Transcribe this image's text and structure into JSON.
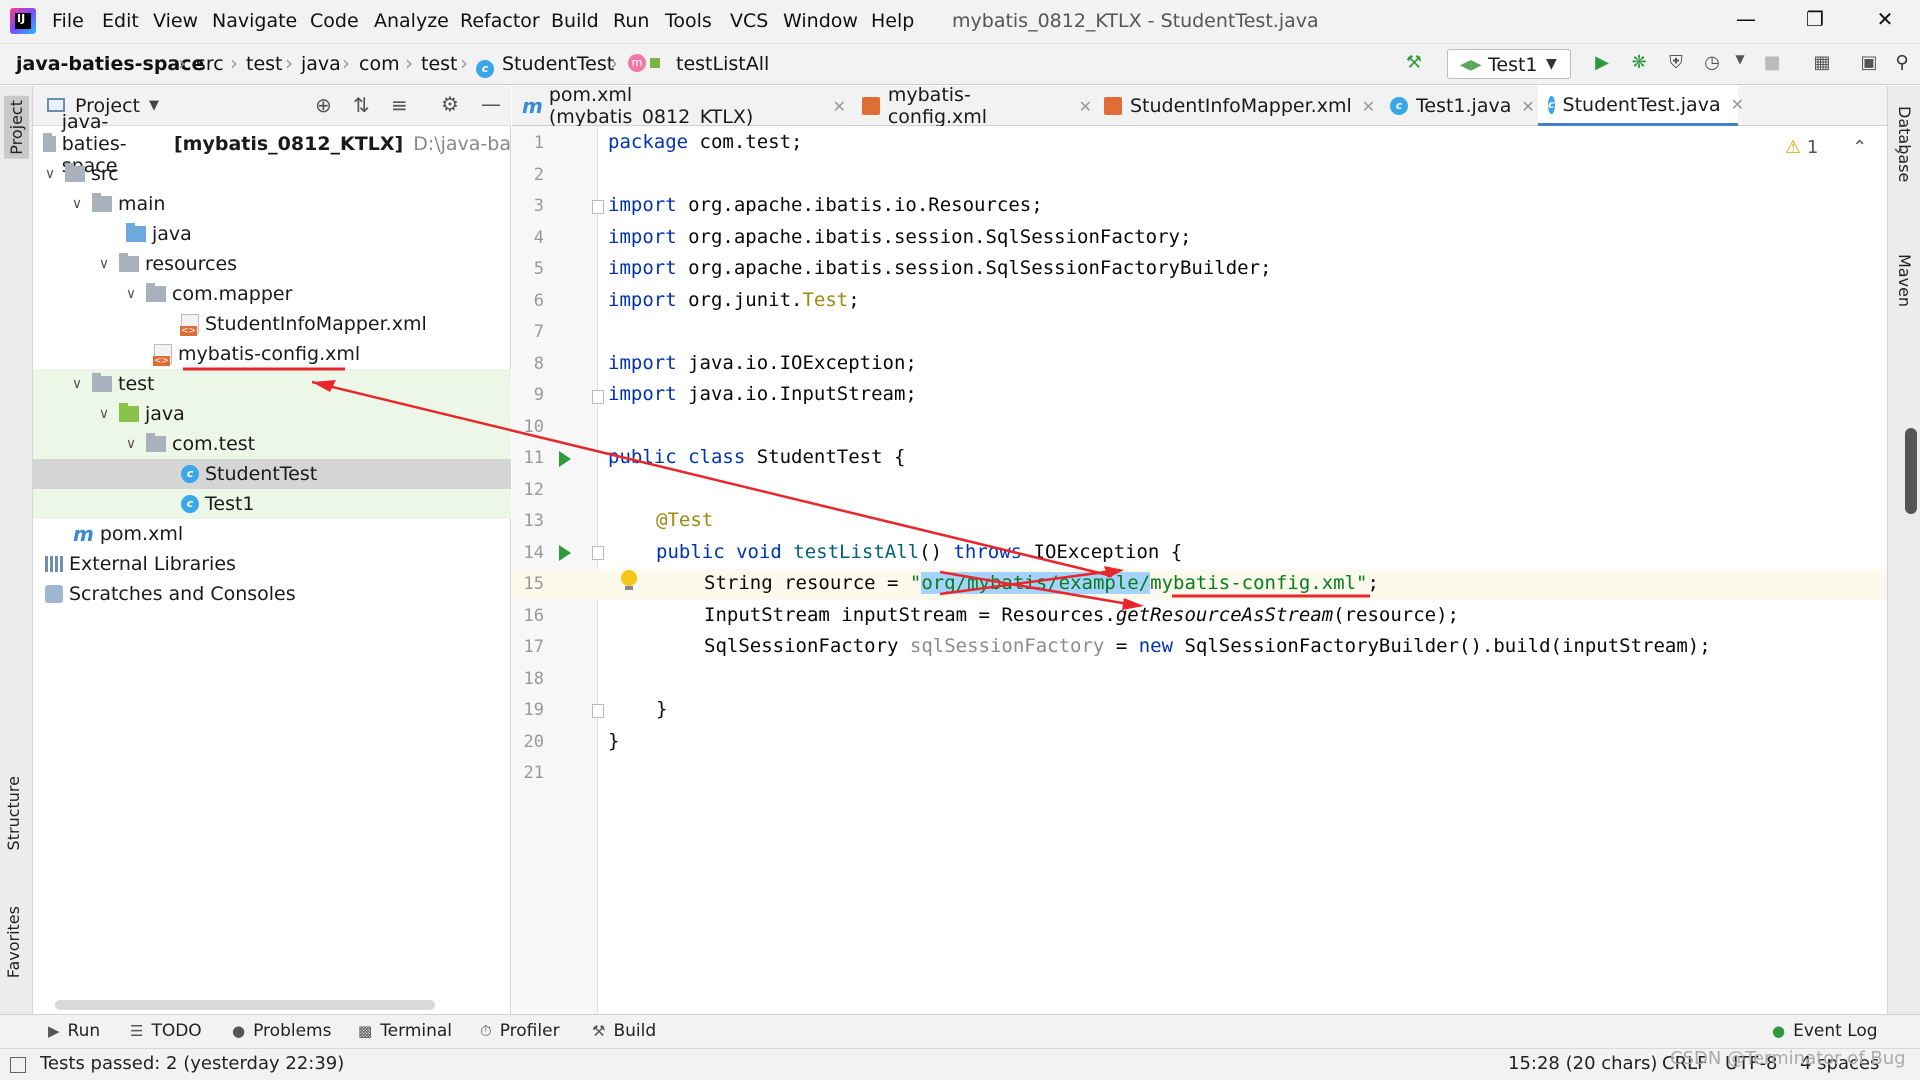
{
  "menubar": {
    "items": [
      "File",
      "Edit",
      "View",
      "Navigate",
      "Code",
      "Analyze",
      "Refactor",
      "Build",
      "Run",
      "Tools",
      "VCS",
      "Window",
      "Help"
    ],
    "window_title": "mybatis_0812_KTLX - StudentTest.java"
  },
  "breadcrumb": {
    "project": "java-baties-space",
    "parts": [
      "src",
      "test",
      "java",
      "com",
      "test",
      "StudentTest",
      "testListAll"
    ]
  },
  "toolbar": {
    "run_config": "Test1"
  },
  "left_stripe": {
    "project_tab": "Project",
    "structure_tab": "Structure",
    "favorites_tab": "Favorites"
  },
  "right_stripe": {
    "database_tab": "Database",
    "maven_tab": "Maven"
  },
  "project_panel": {
    "title": "Project",
    "root_name": "java-baties-space",
    "root_module": "[mybatis_0812_KTLX]",
    "root_path": "D:\\java-ba",
    "tree": [
      {
        "label": "src"
      },
      {
        "label": "main"
      },
      {
        "label": "java"
      },
      {
        "label": "resources"
      },
      {
        "label": "com.mapper"
      },
      {
        "label": "StudentInfoMapper.xml"
      },
      {
        "label": "mybatis-config.xml"
      },
      {
        "label": "test"
      },
      {
        "label": "java"
      },
      {
        "label": "com.test"
      },
      {
        "label": "StudentTest"
      },
      {
        "label": "Test1"
      },
      {
        "label": "pom.xml"
      },
      {
        "label": "External Libraries"
      },
      {
        "label": "Scratches and Consoles"
      }
    ]
  },
  "editor_tabs": [
    {
      "label": "pom.xml (mybatis_0812_KTLX)"
    },
    {
      "label": "mybatis-config.xml"
    },
    {
      "label": "StudentInfoMapper.xml"
    },
    {
      "label": "Test1.java"
    },
    {
      "label": "StudentTest.java"
    }
  ],
  "editor": {
    "warning_count": "1",
    "line_numbers": [
      "1",
      "2",
      "3",
      "4",
      "5",
      "6",
      "7",
      "8",
      "9",
      "10",
      "11",
      "12",
      "13",
      "14",
      "15",
      "16",
      "17",
      "18",
      "19",
      "20",
      "21"
    ],
    "code": {
      "l1_kw": "package",
      "l1_rest": " com.test;",
      "l3_kw": "import",
      "l3_rest": " org.apache.ibatis.io.Resources;",
      "l4_kw": "import",
      "l4_rest": " org.apache.ibatis.session.SqlSessionFactory;",
      "l5_kw": "import",
      "l5_rest": " org.apache.ibatis.session.SqlSessionFactoryBuilder;",
      "l6_kw": "import",
      "l6_rest": " org.junit.",
      "l6_ann": "Test",
      "l6_end": ";",
      "l8_kw": "import",
      "l8_rest": " java.io.IOException;",
      "l9_kw": "import",
      "l9_rest": " java.io.InputStream;",
      "l11_kw1": "public",
      "l11_kw2": " class",
      "l11_rest": " StudentTest {",
      "l13_ann": "@Test",
      "l14_kw1": "public",
      "l14_kw2": " void",
      "l14_name": " testListAll",
      "l14_paren": "() ",
      "l14_kw3": "throws",
      "l14_rest": " IOException {",
      "l15_a": "String resource = ",
      "l15_q1": "\"",
      "l15_sel": "org/mybatis/example/",
      "l15_b": "mybatis-config.xml\"",
      "l15_end": ";",
      "l16_a": "InputStream inputStream = Resources.",
      "l16_m": "getResourceAsStream",
      "l16_b": "(resource);",
      "l17_a": "SqlSessionFactory ",
      "l17_var": "sqlSessionFactory",
      "l17_b": " = ",
      "l17_kw": "new",
      "l17_c": " SqlSessionFactoryBuilder().build(inputStream);",
      "l19": "}",
      "l20": "}"
    }
  },
  "tool_windows": {
    "run": "Run",
    "todo": "TODO",
    "problems": "Problems",
    "terminal": "Terminal",
    "profiler": "Profiler",
    "build": "Build",
    "event_log": "Event Log"
  },
  "status_bar": {
    "tests": "Tests passed: 2 (yesterday 22:39)",
    "position": "15:28 (20 chars)",
    "line_sep": "CRLF",
    "encoding": "UTF-8",
    "indent": "4 spaces",
    "watermark": "CSDN @Terminator of Bug"
  },
  "colors": {
    "annotation_red": "#e8262b",
    "accent_blue": "#4083c9",
    "keyword": "#0033b3",
    "string": "#067d17"
  }
}
